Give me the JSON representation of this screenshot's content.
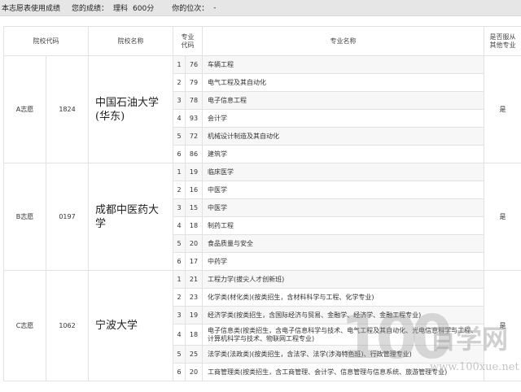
{
  "header": {
    "title": "本志愿表使用成绩",
    "score_label": "您的成绩：",
    "subject": "理科",
    "score": "600分",
    "rank_label": "你的位次：",
    "rank_value": "-"
  },
  "columns": {
    "college_code": "院校代码",
    "college_name": "院校名称",
    "major_code": "专业\n代码",
    "major_name": "专业名称",
    "accept_other": "是否服从\n其他专业"
  },
  "choices": [
    {
      "label": "A志愿",
      "code": "1824",
      "school": "中国石油大学\n(华东)",
      "accept": "是",
      "majors": [
        {
          "order": "1",
          "code": "76",
          "name": "车辆工程"
        },
        {
          "order": "2",
          "code": "79",
          "name": "电气工程及其自动化"
        },
        {
          "order": "3",
          "code": "78",
          "name": "电子信息工程"
        },
        {
          "order": "4",
          "code": "93",
          "name": "会计学"
        },
        {
          "order": "5",
          "code": "72",
          "name": "机械设计制造及其自动化"
        },
        {
          "order": "6",
          "code": "86",
          "name": "建筑学"
        }
      ]
    },
    {
      "label": "B志愿",
      "code": "0197",
      "school": "成都中医药大\n学",
      "accept": "是",
      "majors": [
        {
          "order": "1",
          "code": "19",
          "name": "临床医学"
        },
        {
          "order": "2",
          "code": "16",
          "name": "中医学"
        },
        {
          "order": "3",
          "code": "15",
          "name": "中医学"
        },
        {
          "order": "4",
          "code": "18",
          "name": "制药工程"
        },
        {
          "order": "5",
          "code": "20",
          "name": "食品质量与安全"
        },
        {
          "order": "6",
          "code": "17",
          "name": "中药学"
        }
      ]
    },
    {
      "label": "C志愿",
      "code": "1062",
      "school": "宁波大学",
      "accept": "是",
      "majors": [
        {
          "order": "1",
          "code": "21",
          "name": "工程力学(拔尖人才创新班)"
        },
        {
          "order": "2",
          "code": "23",
          "name": "化学类(材化类)(按类招生，含材料科学与工程、化学专业)"
        },
        {
          "order": "3",
          "code": "19",
          "name": "经济学类(按类招生，含国际经济与贸易、金融学、经济学、金融工程专业)"
        },
        {
          "order": "4",
          "code": "18",
          "name": "电子信息类(按类招生，含电子信息科学与技术、电气工程及其自动化、光电信息科学与工程、计算机科学与技术、物联网工程专业)"
        },
        {
          "order": "5",
          "code": "25",
          "name": "法学类(法政类)(按类招生，含法学、法学(涉海特色班)、行政管理专业)"
        },
        {
          "order": "6",
          "code": "20",
          "name": "工商管理类(按类招生，含工商管理、会计学、信息管理与信息系统、旅游管理专业)"
        }
      ]
    }
  ],
  "watermark": {
    "number": "100",
    "text": "百学网",
    "url": "www.100xue.net"
  }
}
